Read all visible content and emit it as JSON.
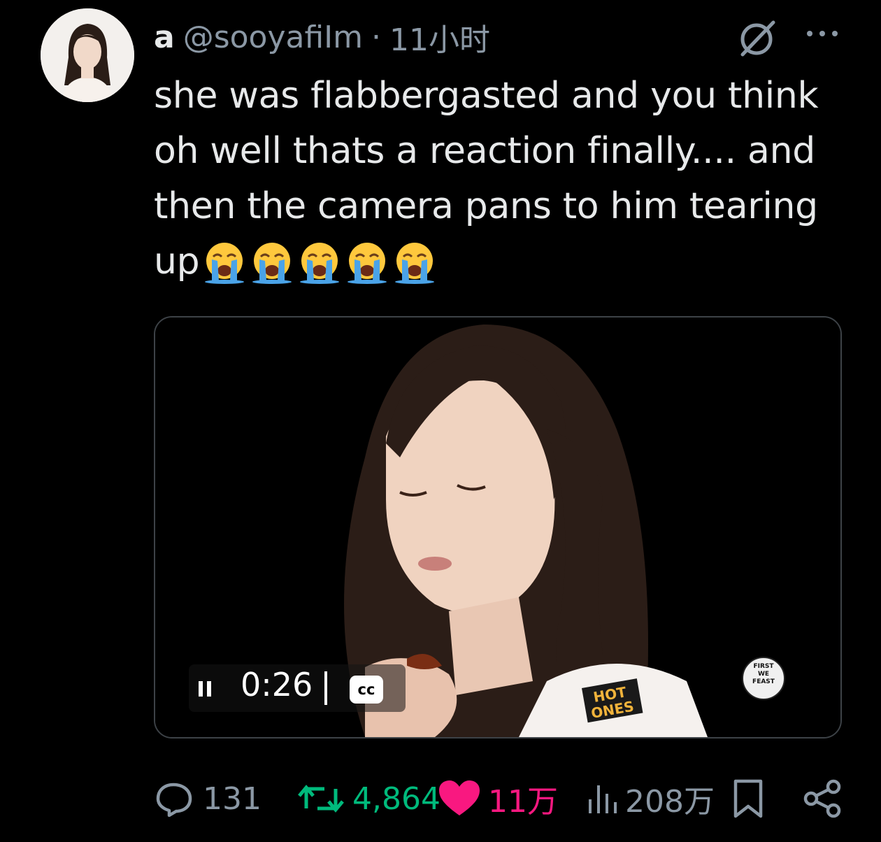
{
  "tweet": {
    "display_name": "a",
    "handle": "@sooyafiIm",
    "separator": "·",
    "time": "11小时",
    "text": "she was flabbergasted and you think oh well thats a reaction finally.... and then the camera pans to him tearing up",
    "emojis": [
      "loudly-crying-face",
      "loudly-crying-face",
      "loudly-crying-face",
      "loudly-crying-face",
      "loudly-crying-face"
    ]
  },
  "video": {
    "time": "0:26",
    "cc_label": "cc",
    "logo_text": "HOT ONES",
    "badge_text": "FIRST WE FEAST"
  },
  "actions": {
    "replies": "131",
    "retweets": "4,864",
    "likes": "11万",
    "views": "208万"
  },
  "colors": {
    "background": "#000000",
    "text": "#e7e9ea",
    "muted": "#8b98a5",
    "retweet": "#00ba7c",
    "like": "#f91880",
    "border": "#3d4247"
  },
  "icons": [
    "grok-icon",
    "more-icon",
    "pause-icon",
    "reply-icon",
    "retweet-icon",
    "heart-icon",
    "views-icon",
    "bookmark-icon",
    "share-icon"
  ]
}
